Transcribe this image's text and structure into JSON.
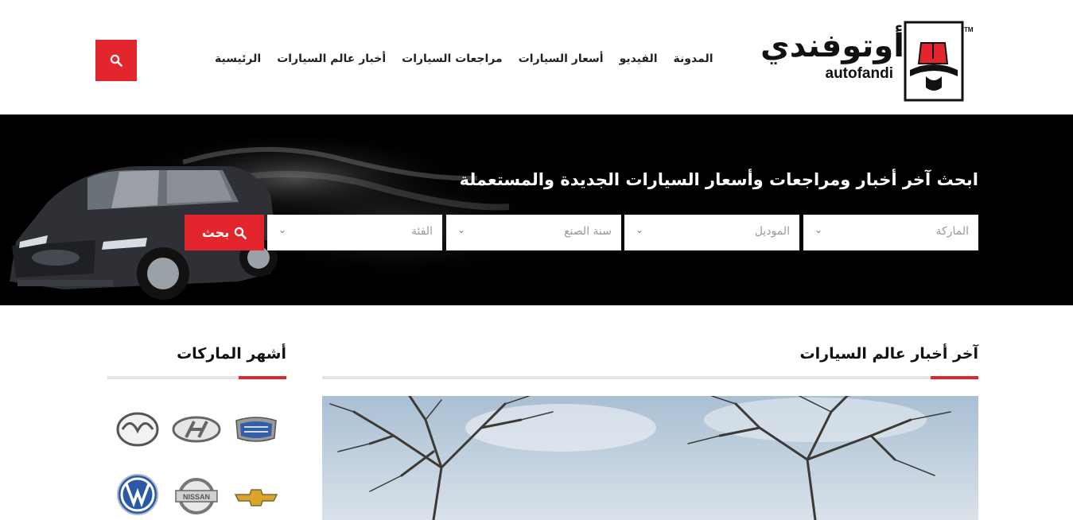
{
  "header": {
    "nav": [
      {
        "label": "الرئيسية"
      },
      {
        "label": "أخبار عالم السيارات"
      },
      {
        "label": "مراجعات السيارات"
      },
      {
        "label": "أسعار السيارات"
      },
      {
        "label": "الفيديو"
      },
      {
        "label": "المدونة"
      }
    ],
    "logo": {
      "arabic": "أوتوفندي",
      "latin": "autofandi",
      "trademark": "TM"
    },
    "search_icon": "search-icon"
  },
  "hero": {
    "title": "ابحث آخر أخبار ومراجعات وأسعار السيارات الجديدة والمستعملة",
    "selects": [
      {
        "placeholder": "الماركة"
      },
      {
        "placeholder": "الموديل"
      },
      {
        "placeholder": "سنة الصنع"
      },
      {
        "placeholder": "الفئة"
      }
    ],
    "search_button": "بحث"
  },
  "news": {
    "title": "آخر أخبار عالم السيارات"
  },
  "brands": {
    "title": "أشهر الماركات",
    "items": [
      {
        "name": "geely-logo-icon"
      },
      {
        "name": "hyundai-logo-icon"
      },
      {
        "name": "mazda-logo-icon"
      },
      {
        "name": "chevrolet-logo-icon"
      },
      {
        "name": "nissan-logo-icon",
        "text": "NISSAN"
      },
      {
        "name": "volkswagen-logo-icon"
      }
    ]
  },
  "colors": {
    "accent": "#e3262d",
    "hero_bg": "#000000",
    "rule": "#e5e5e5"
  }
}
